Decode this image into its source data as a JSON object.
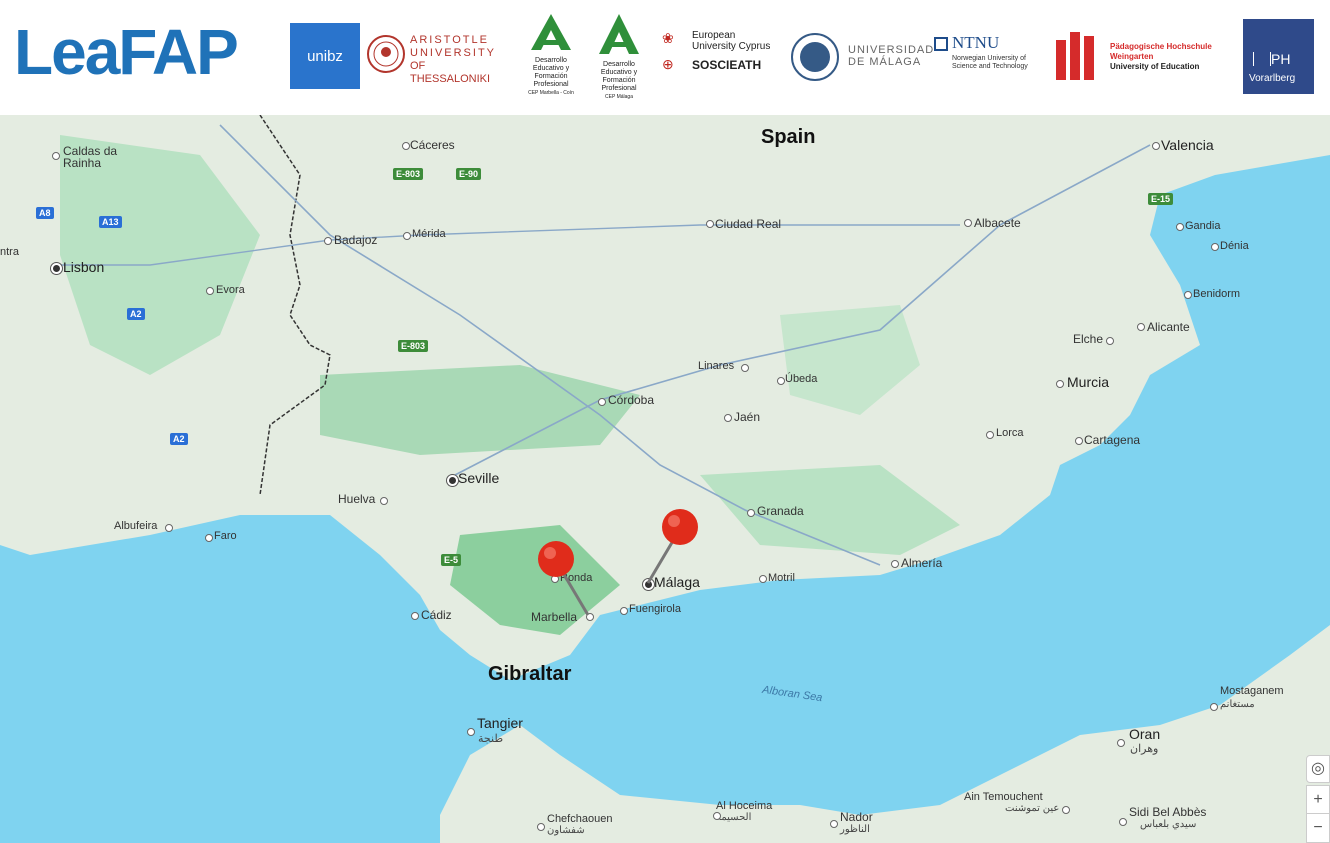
{
  "header": {
    "leafap": "LeaFAP",
    "unibz": "unibz",
    "aristotle_l1": "ARISTOTLE",
    "aristotle_l2": "UNIVERSITY",
    "aristotle_l3": "OF THESSALONIKI",
    "cep1": [
      "Desarrollo",
      "Educativo y",
      "Formación",
      "Profesional",
      "CEP Marbella - Coín"
    ],
    "cep2": [
      "Desarrollo",
      "Educativo y",
      "Formación",
      "Profesional",
      "CEP Málaga"
    ],
    "euc_l1": "European",
    "euc_l2": "University Cyprus",
    "soscieath": "SOSCIEATH",
    "uma_l1": "UNIVERSIDAD",
    "uma_l2": "DE MÁLAGA",
    "ntnu": "NTNU",
    "ntnu_l1": "Norwegian University of",
    "ntnu_l2": "Science and Technology",
    "ph_w_l1": "Pädagogische Hochschule",
    "ph_w_l2": "Weingarten",
    "ph_w_l3": "University of Education",
    "ph_v_l1": "PH",
    "ph_v_l2": "Vorarlberg"
  },
  "map": {
    "regions": {
      "spain": "Spain",
      "gibraltar": "Gibraltar",
      "sea": "Alboran Sea"
    },
    "cities": {
      "caldas1": "Caldas da",
      "caldas2": "Rainha",
      "caceres": "Cáceres",
      "badajoz": "Badajoz",
      "merida": "Mérida",
      "lisbon": "Lisbon",
      "evora": "Evora",
      "ciudad_real": "Ciudad Real",
      "albacete": "Albacete",
      "valencia": "Valencia",
      "gandia": "Gandia",
      "denia": "Dénia",
      "benidorm": "Benidorm",
      "alicante": "Alicante",
      "elche": "Elche",
      "murcia": "Murcia",
      "cartagena": "Cartagena",
      "lorca": "Lorca",
      "linares": "Linares",
      "ubeda": "Úbeda",
      "cordoba": "Córdoba",
      "jaen": "Jaén",
      "seville": "Seville",
      "huelva": "Huelva",
      "albufeira": "Albufeira",
      "faro": "Faro",
      "granada": "Granada",
      "almeria": "Almería",
      "motril": "Motril",
      "malaga": "Málaga",
      "fuengirola": "Fuengirola",
      "marbella": "Marbella",
      "ronda": "Ronda",
      "cadiz": "Cádiz",
      "tangier": "Tangier",
      "tangier_ar": "طنجة",
      "oran": "Oran",
      "oran_ar": "وهران",
      "mostaganem": "Mostaganem",
      "mostaganem_ar": "مستغانم",
      "ain": "Ain Temouchent",
      "ain_ar": "عين تموشنت",
      "sidi": "Sidi Bel Abbès",
      "sidi_ar": "سيدي بلعباس",
      "nador": "Nador",
      "nador_ar": "الناظور",
      "alhoceima": "Al Hoceima",
      "alhoceima_ar": "الحسيمة",
      "chefchaouen": "Chefchaouen",
      "chefchaouen_ar": "شفشاون",
      "ntra": "ntra"
    },
    "roads": {
      "e803a": "E-803",
      "e90": "E-90",
      "e803b": "E-803",
      "e5": "E-5",
      "e15": "E-15",
      "a8": "A8",
      "a13": "A13",
      "a2a": "A2",
      "a2b": "A2"
    },
    "pins": [
      "Ronda pin",
      "Málaga pin"
    ],
    "controls": {
      "zoom_in": "+",
      "zoom_out": "−"
    }
  }
}
